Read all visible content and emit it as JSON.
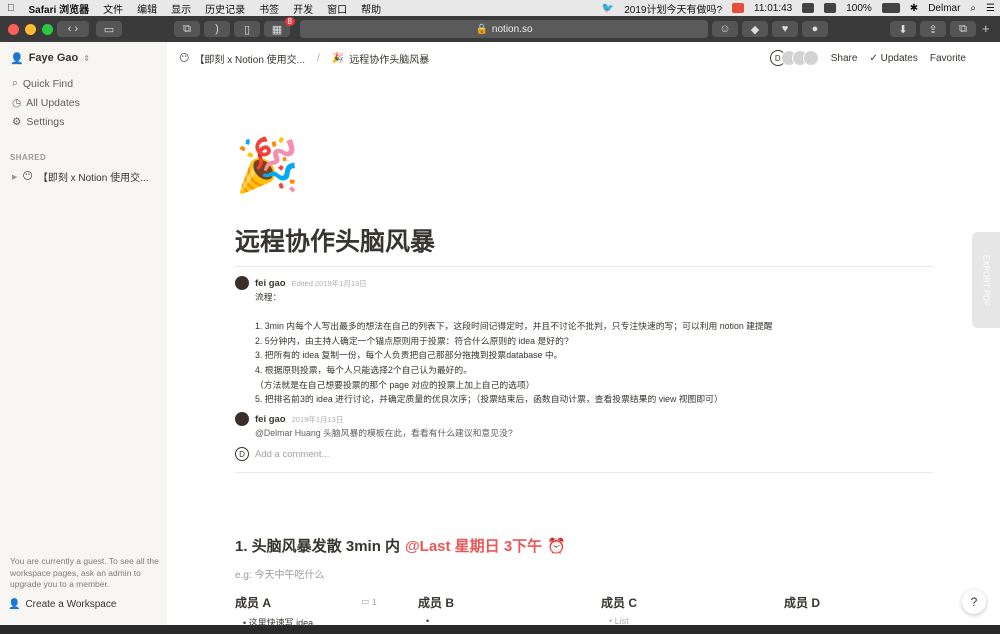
{
  "menubar": {
    "app": "Safari 浏览器",
    "menus": [
      "文件",
      "编辑",
      "显示",
      "历史记录",
      "书签",
      "开发",
      "窗口",
      "帮助"
    ],
    "reminder": "2019计划今天有做吗?",
    "time": "11:01:43",
    "battery": "100%",
    "user": "Delmar"
  },
  "browser": {
    "url": "notion.so",
    "tab_badge": "8"
  },
  "sidebar": {
    "workspace": "Faye Gao",
    "links": [
      {
        "label": "Quick Find",
        "icon": "search-icon"
      },
      {
        "label": "All Updates",
        "icon": "clock-icon"
      },
      {
        "label": "Settings",
        "icon": "gear-icon"
      }
    ],
    "section": "SHARED",
    "shared_page": "【即刻 x Notion 使用交...",
    "guest_note": "You are currently a guest. To see all the workspace pages, ask an admin to upgrade you to a member.",
    "create_workspace": "Create a Workspace"
  },
  "topbar": {
    "crumb1": "【即刻 x Notion 使用交...",
    "crumb2": "远程协作头脑风暴",
    "avatar_letter": "D",
    "share": "Share",
    "updates": "Updates",
    "favorite": "Favorite"
  },
  "page": {
    "emoji": "🎉",
    "title": "远程协作头脑风暴",
    "comments": [
      {
        "author": "fei gao",
        "date": "Edited 2019年1月13日",
        "body": "流程：\n\n1. 3min 内每个人写出最多的想法在自己的列表下，这段时间记得定时，并且不讨论不批判，只专注快速的写；可以利用 notion 建提醒\n2. 5分钟内，由主持人确定一个锚点原则用于投票：符合什么原则的 idea 是好的?\n3. 把所有的 idea 复制一份，每个人负责把自己那部分拖拽到投票database 中。\n4. 根据原则投票，每个人只能选择2个自己认为最好的。\n（方法就是在自己想要投票的那个 page 对应的投票上加上自己的选项）\n5. 把排名前3的 idea 进行讨论，并确定质量的优良次序；（投票结束后，函数自动计票，查看投票结果的 view 视图即可）"
      },
      {
        "author": "fei gao",
        "date": "2019年1月13日",
        "body": "@Delmar Huang 头脑风暴的模板在此，看看有什么建议和意见没?"
      }
    ],
    "add_comment": "Add a comment...",
    "heading": "1. 头脑风暴发散 3min 内",
    "mention": "@Last 星期日 3下午",
    "subtitle": "e.g: 今天中午吃什么",
    "members": [
      "成员 A",
      "成员 B",
      "成员 C",
      "成员 D"
    ],
    "member_a_comments": "1",
    "member_a_item": "这里快速写 idea",
    "member_c_item": "List"
  },
  "help": "?",
  "side_tab": "EXPORT PDF"
}
